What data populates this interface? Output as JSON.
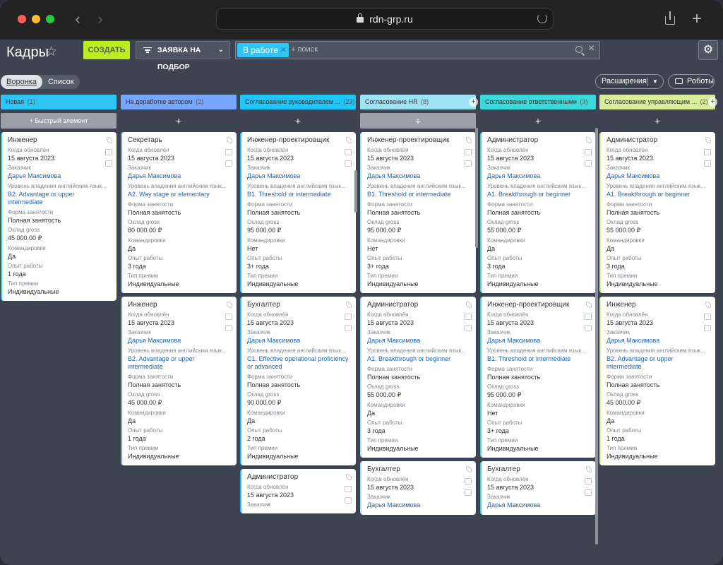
{
  "browser": {
    "url": "rdn-grp.ru"
  },
  "toolbar": {
    "title": "Кадры",
    "create_label": "СОЗДАТЬ",
    "request_label": "ЗАЯВКА НА ПОДБОР",
    "filter_chip": "В работе",
    "search_placeholder": "+ поиск"
  },
  "views": {
    "funnel": "Воронка",
    "list": "Список"
  },
  "actions": {
    "extensions": "Расширения",
    "robots": "Роботы"
  },
  "columns": [
    {
      "title": "Новая",
      "count": "(1)",
      "color": "#2fc6f6",
      "quick": "+ Быстрый элемент",
      "cards": [
        {
          "title": "Инженер",
          "fields": [
            {
              "l": "Когда обновлён",
              "v": "15 августа 2023",
              "t": "val"
            },
            {
              "l": "Заказчик",
              "v": "Дарья Максимова",
              "t": "lnk"
            },
            {
              "l": "Уровень владения английским язык...",
              "v": "B2. Advantage or upper intermediate",
              "t": "lnk"
            },
            {
              "l": "Форма занятости",
              "v": "Полная занятость",
              "t": "val"
            },
            {
              "l": "Оклад gross",
              "v": "45 000.00 ₽",
              "t": "val"
            },
            {
              "l": "Командировки",
              "v": "Да",
              "t": "val"
            },
            {
              "l": "Опыт работы",
              "v": "1 года",
              "t": "val"
            },
            {
              "l": "Тип премии",
              "v": "Индивидуальные",
              "t": "val"
            }
          ]
        }
      ]
    },
    {
      "title": "На доработке автором",
      "count": "(2)",
      "color": "#77a6ff",
      "cards": [
        {
          "title": "Секретарь",
          "fields": [
            {
              "l": "Когда обновлён",
              "v": "15 августа 2023",
              "t": "val"
            },
            {
              "l": "Заказчик",
              "v": "Дарья Максимова",
              "t": "lnk"
            },
            {
              "l": "Уровень владения английским язык...",
              "v": "A2. Way stage or elementary",
              "t": "lnk"
            },
            {
              "l": "Форма занятости",
              "v": "Полная занятость",
              "t": "val"
            },
            {
              "l": "Оклад gross",
              "v": "80 000.00 ₽",
              "t": "val"
            },
            {
              "l": "Командировки",
              "v": "Да",
              "t": "val"
            },
            {
              "l": "Опыт работы",
              "v": "3 года",
              "t": "val"
            },
            {
              "l": "Тип премии",
              "v": "Индивидуальные",
              "t": "val"
            }
          ]
        },
        {
          "title": "Инженер",
          "fields": [
            {
              "l": "Когда обновлён",
              "v": "15 августа 2023",
              "t": "val"
            },
            {
              "l": "Заказчик",
              "v": "Дарья Максимова",
              "t": "lnk"
            },
            {
              "l": "Уровень владения английским язык...",
              "v": "B2. Advantage or upper intermediate",
              "t": "lnk"
            },
            {
              "l": "Форма занятости",
              "v": "Полная занятость",
              "t": "val"
            },
            {
              "l": "Оклад gross",
              "v": "45 000.00 ₽",
              "t": "val"
            },
            {
              "l": "Командировки",
              "v": "Да",
              "t": "val"
            },
            {
              "l": "Опыт работы",
              "v": "1 года",
              "t": "val"
            },
            {
              "l": "Тип премии",
              "v": "Индивидуальные",
              "t": "val"
            }
          ]
        }
      ]
    },
    {
      "title": "Согласование руководителем ...",
      "count": "(23)",
      "color": "#1ec6fa",
      "cards": [
        {
          "title": "Инженер-проектировщик",
          "fields": [
            {
              "l": "Когда обновлён",
              "v": "15 августа 2023",
              "t": "val"
            },
            {
              "l": "Заказчик",
              "v": "Дарья Максимова",
              "t": "lnk"
            },
            {
              "l": "Уровень владения английским язык...",
              "v": "B1. Threshold or intermediate",
              "t": "lnk"
            },
            {
              "l": "Форма занятости",
              "v": "Полная занятость",
              "t": "val"
            },
            {
              "l": "Оклад gross",
              "v": "95 000.00 ₽",
              "t": "val"
            },
            {
              "l": "Командировки",
              "v": "Нет",
              "t": "val"
            },
            {
              "l": "Опыт работы",
              "v": "3+ года",
              "t": "val"
            },
            {
              "l": "Тип премии",
              "v": "Индивидуальные",
              "t": "val"
            }
          ]
        },
        {
          "title": "Бухгалтер",
          "fields": [
            {
              "l": "Когда обновлён",
              "v": "15 августа 2023",
              "t": "val"
            },
            {
              "l": "Заказчик",
              "v": "Дарья Максимова",
              "t": "lnk"
            },
            {
              "l": "Уровень владения английским язык...",
              "v": "C1. Effective operational proficiency or advanced",
              "t": "lnk"
            },
            {
              "l": "Форма занятости",
              "v": "Полная занятость",
              "t": "val"
            },
            {
              "l": "Оклад gross",
              "v": "90 000.00 ₽",
              "t": "val"
            },
            {
              "l": "Командировки",
              "v": "Да",
              "t": "val"
            },
            {
              "l": "Опыт работы",
              "v": "2 года",
              "t": "val"
            },
            {
              "l": "Тип премии",
              "v": "Индивидуальные",
              "t": "val"
            }
          ]
        },
        {
          "title": "Администратор",
          "fields": [
            {
              "l": "Когда обновлён",
              "v": "15 августа 2023",
              "t": "val"
            },
            {
              "l": "Заказчик",
              "v": "",
              "t": "lnk"
            }
          ]
        }
      ]
    },
    {
      "title": "Согласование HR",
      "count": "(8)",
      "color": "#9ee3f5",
      "cards": [
        {
          "title": "Инженер-проектировщик",
          "fields": [
            {
              "l": "Когда обновлён",
              "v": "15 августа 2023",
              "t": "val"
            },
            {
              "l": "Заказчик",
              "v": "Дарья Максимова",
              "t": "lnk"
            },
            {
              "l": "Уровень владения английским язык...",
              "v": "B1. Threshold or intermediate",
              "t": "lnk"
            },
            {
              "l": "Форма занятости",
              "v": "Полная занятость",
              "t": "val"
            },
            {
              "l": "Оклад gross",
              "v": "95 000.00 ₽",
              "t": "val"
            },
            {
              "l": "Командировки",
              "v": "Нет",
              "t": "val"
            },
            {
              "l": "Опыт работы",
              "v": "3+ года",
              "t": "val"
            },
            {
              "l": "Тип премии",
              "v": "Индивидуальные",
              "t": "val"
            }
          ]
        },
        {
          "title": "Администратор",
          "fields": [
            {
              "l": "Когда обновлён",
              "v": "15 августа 2023",
              "t": "val"
            },
            {
              "l": "Заказчик",
              "v": "Дарья Максимова",
              "t": "lnk"
            },
            {
              "l": "Уровень владения английским язык...",
              "v": "A1. Breakthrough or beginner",
              "t": "lnk"
            },
            {
              "l": "Форма занятости",
              "v": "Полная занятость",
              "t": "val"
            },
            {
              "l": "Оклад gross",
              "v": "55 000.00 ₽",
              "t": "val"
            },
            {
              "l": "Командировки",
              "v": "Да",
              "t": "val"
            },
            {
              "l": "Опыт работы",
              "v": "3 года",
              "t": "val"
            },
            {
              "l": "Тип премии",
              "v": "Индивидуальные",
              "t": "val"
            }
          ]
        },
        {
          "title": "Бухгалтер",
          "fields": [
            {
              "l": "Когда обновлён",
              "v": "15 августа 2023",
              "t": "val"
            },
            {
              "l": "Заказчик",
              "v": "Дарья Максимова",
              "t": "lnk"
            }
          ]
        }
      ]
    },
    {
      "title": "Согласование ответственными",
      "count": "(3)",
      "color": "#3bd9d9",
      "cards": [
        {
          "title": "Администратор",
          "fields": [
            {
              "l": "Когда обновлён",
              "v": "15 августа 2023",
              "t": "val"
            },
            {
              "l": "Заказчик",
              "v": "Дарья Максимова",
              "t": "lnk"
            },
            {
              "l": "Уровень владения английским язык...",
              "v": "A1. Breakthrough or beginner",
              "t": "lnk"
            },
            {
              "l": "Форма занятости",
              "v": "Полная занятость",
              "t": "val"
            },
            {
              "l": "Оклад gross",
              "v": "55 000.00 ₽",
              "t": "val"
            },
            {
              "l": "Командировки",
              "v": "Да",
              "t": "val"
            },
            {
              "l": "Опыт работы",
              "v": "3 года",
              "t": "val"
            },
            {
              "l": "Тип премии",
              "v": "Индивидуальные",
              "t": "val"
            }
          ]
        },
        {
          "title": "Инженер-проектировщик",
          "fields": [
            {
              "l": "Когда обновлён",
              "v": "15 августа 2023",
              "t": "val"
            },
            {
              "l": "Заказчик",
              "v": "Дарья Максимова",
              "t": "lnk"
            },
            {
              "l": "Уровень владения английским язык...",
              "v": "B1. Threshold or intermediate",
              "t": "lnk"
            },
            {
              "l": "Форма занятости",
              "v": "Полная занятость",
              "t": "val"
            },
            {
              "l": "Оклад gross",
              "v": "95 000.00 ₽",
              "t": "val"
            },
            {
              "l": "Командировки",
              "v": "Нет",
              "t": "val"
            },
            {
              "l": "Опыт работы",
              "v": "3+ года",
              "t": "val"
            },
            {
              "l": "Тип премии",
              "v": "Индивидуальные",
              "t": "val"
            }
          ]
        },
        {
          "title": "Бухгалтер",
          "fields": [
            {
              "l": "Когда обновлён",
              "v": "15 августа 2023",
              "t": "val"
            },
            {
              "l": "Заказчик",
              "v": "Дарья Максимова",
              "t": "lnk"
            }
          ]
        }
      ]
    },
    {
      "title": "Согласование управляющим ...",
      "count": "(2)",
      "color": "#d7ee9b",
      "cards": [
        {
          "title": "Администратор",
          "fields": [
            {
              "l": "Когда обновлён",
              "v": "15 августа 2023",
              "t": "val"
            },
            {
              "l": "Заказчик",
              "v": "Дарья Максимова",
              "t": "lnk"
            },
            {
              "l": "Уровень владения английским язык...",
              "v": "A1. Breakthrough or beginner",
              "t": "lnk"
            },
            {
              "l": "Форма занятости",
              "v": "Полная занятость",
              "t": "val"
            },
            {
              "l": "Оклад gross",
              "v": "55 000.00 ₽",
              "t": "val"
            },
            {
              "l": "Командировки",
              "v": "Да",
              "t": "val"
            },
            {
              "l": "Опыт работы",
              "v": "3 года",
              "t": "val"
            },
            {
              "l": "Тип премии",
              "v": "Индивидуальные",
              "t": "val"
            }
          ]
        },
        {
          "title": "Инженер",
          "fields": [
            {
              "l": "Когда обновлён",
              "v": "15 августа 2023",
              "t": "val"
            },
            {
              "l": "Заказчик",
              "v": "Дарья Максимова",
              "t": "lnk"
            },
            {
              "l": "Уровень владения английским язык...",
              "v": "B2. Advantage or upper intermediate",
              "t": "lnk"
            },
            {
              "l": "Форма занятости",
              "v": "Полная занятость",
              "t": "val"
            },
            {
              "l": "Оклад gross",
              "v": "45 000.00 ₽",
              "t": "val"
            },
            {
              "l": "Командировки",
              "v": "Да",
              "t": "val"
            },
            {
              "l": "Опыт работы",
              "v": "1 года",
              "t": "val"
            },
            {
              "l": "Тип премии",
              "v": "Индивидуальные",
              "t": "val"
            }
          ]
        }
      ]
    }
  ]
}
